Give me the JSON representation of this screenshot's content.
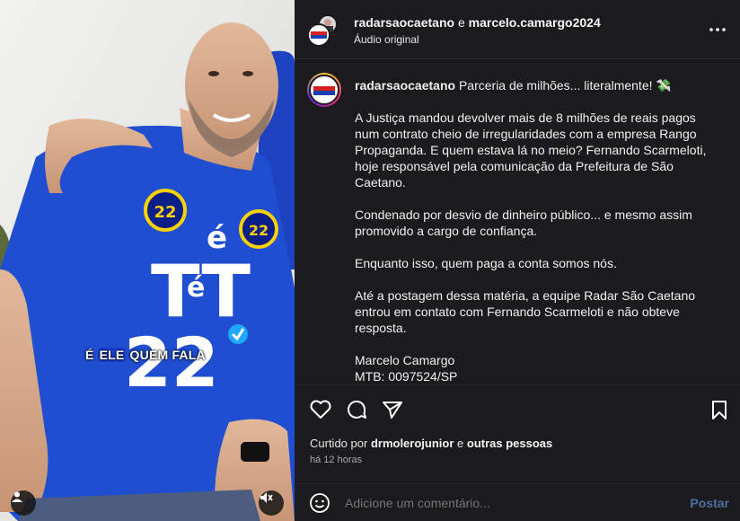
{
  "media": {
    "caption_pre": "É ",
    "caption_hl": "ELE",
    "caption_post": " QUEM FALA",
    "shirt_text": "é TT é 22",
    "badge_number": "22"
  },
  "header": {
    "user1": "radarsaocaetano",
    "conj": "e",
    "user2": "marcelo.camargo2024",
    "audio": "Áudio original"
  },
  "post": {
    "username": "radarsaocaetano",
    "intro": "Parceria de milhões... literalmente! 💸",
    "paragraphs": [
      "A Justiça mandou devolver mais de 8 milhões de reais pagos num contrato cheio de irregularidades com a empresa Rango Propaganda. E quem estava lá no meio? Fernando Scarmeloti, hoje responsável pela comunicação da Prefeitura de São Caetano.",
      "Condenado por desvio de dinheiro público... e mesmo assim promovido a cargo de confiança.",
      "Enquanto isso, quem paga a conta somos nós.",
      "Até a postagem dessa matéria, a equipe Radar São Caetano entrou em contato com Fernando Scarmeloti e não obteve resposta."
    ],
    "sign_name": "Marcelo Camargo",
    "sign_mtb": "MTB: 0097524/SP"
  },
  "likes": {
    "prefix": "Curtido por",
    "user": "drmolerojunior",
    "conj": "e",
    "others": "outras pessoas"
  },
  "time": "há 12 horas",
  "comment": {
    "placeholder": "Adicione um comentário...",
    "post_label": "Postar"
  },
  "colors": {
    "background": "#1b1b1d",
    "shirt": "#1f4fd0",
    "caption_highlight": "#1a3fd6",
    "post_link": "#4a6fa0"
  }
}
